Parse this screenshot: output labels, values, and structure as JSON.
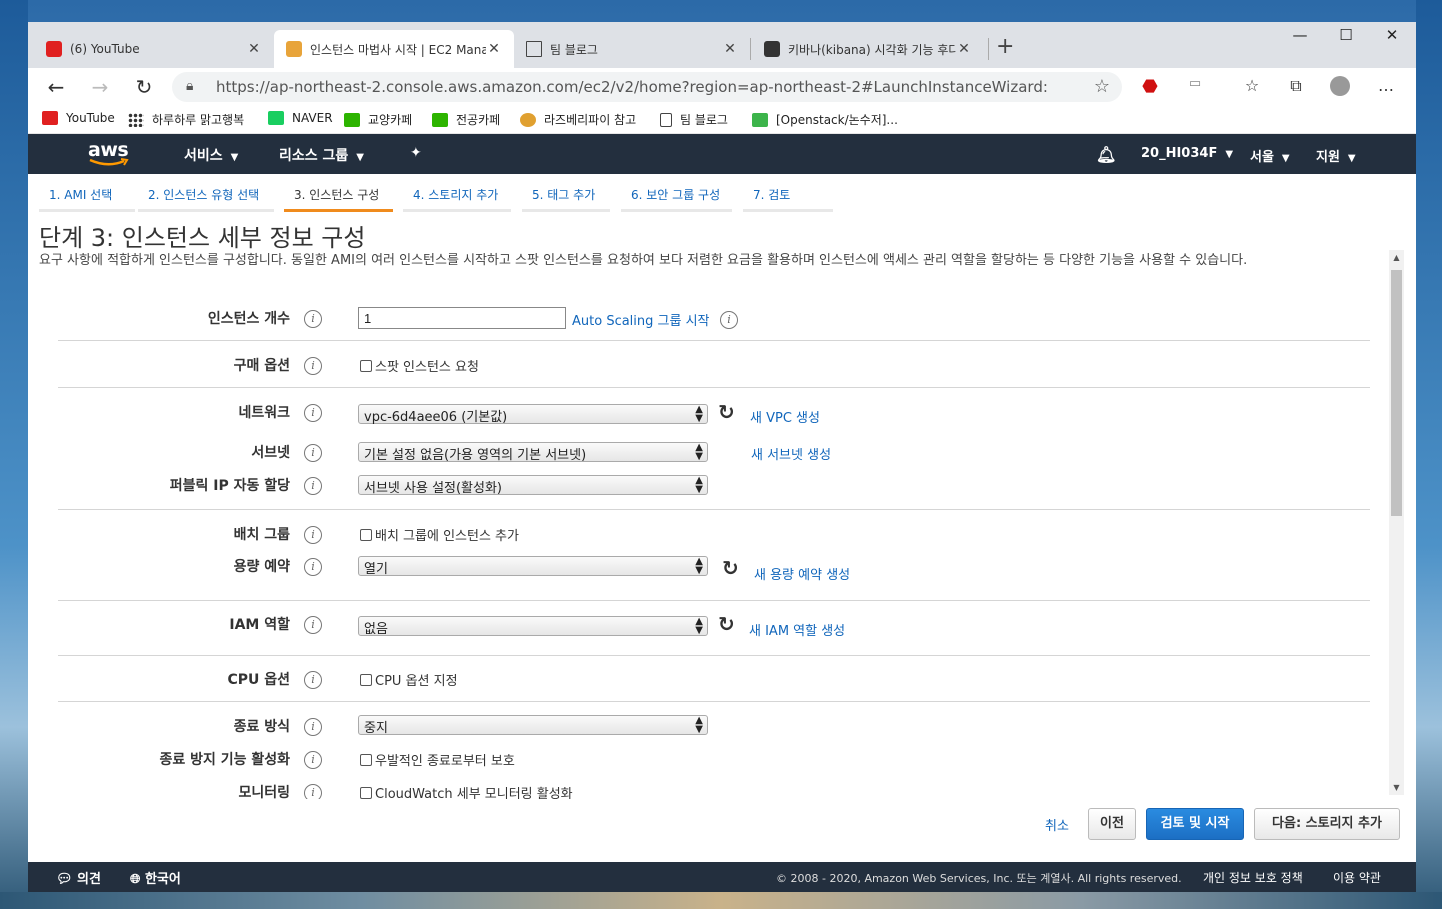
{
  "browser": {
    "tabs": [
      {
        "title": "(6) YouTube"
      },
      {
        "title": "인스턴스 마법사 시작 | EC2 Mana"
      },
      {
        "title": "팀 블로그"
      },
      {
        "title": "키바나(kibana) 시각화 기능 후다"
      }
    ],
    "close_glyph": "✕",
    "new_tab_glyph": "+",
    "window_controls": {
      "minimize": "—",
      "maximize": "☐",
      "close": "✕"
    },
    "url": "https://ap-northeast-2.console.aws.amazon.com/ec2/v2/home?region=ap-northeast-2#LaunchInstanceWizard:",
    "bookmarks": [
      "YouTube",
      "하루하루 맑고행복",
      "NAVER",
      "교양카페",
      "전공카페",
      "라즈베리파이 참고",
      "팀 블로그",
      "[Openstack/논수저]..."
    ],
    "icons": [
      "back-icon",
      "forward-icon",
      "reload-icon",
      "lock-icon",
      "star-icon",
      "stop-icon",
      "reading-icon",
      "favorites-icon",
      "collections-icon",
      "profile-icon",
      "more-icon"
    ]
  },
  "aws_header": {
    "logo": "aws",
    "services": "서비스",
    "resource_groups": "리소스 그룹",
    "account": "20_HI034F",
    "region": "서울",
    "support": "지원"
  },
  "wizard": {
    "steps": [
      "1. AMI 선택",
      "2. 인스턴스 유형 선택",
      "3. 인스턴스 구성",
      "4. 스토리지 추가",
      "5. 태그 추가",
      "6. 보안 그룹 구성",
      "7. 검토"
    ],
    "active_step": 3
  },
  "page": {
    "title": "단계 3: 인스턴스 세부 정보 구성",
    "description": "요구 사항에 적합하게 인스턴스를 구성합니다. 동일한 AMI의 여러 인스턴스를 시작하고 스팟 인스턴스를 요청하여 보다 저렴한 요금을 활용하며 인스턴스에 액세스 관리 역할을 할당하는 등 다양한 기능을 사용할 수 있습니다."
  },
  "form": {
    "instance_count": {
      "label": "인스턴스 개수",
      "value": "1",
      "link": "Auto Scaling 그룹 시작"
    },
    "purchase": {
      "label": "구매 옵션",
      "checkbox": "스팟 인스턴스 요청"
    },
    "network": {
      "label": "네트워크",
      "value": "vpc-6d4aee06 (기본값)",
      "link": "새 VPC 생성"
    },
    "subnet": {
      "label": "서브넷",
      "value": "기본 설정 없음(가용 영역의 기본 서브넷)",
      "link": "새 서브넷 생성"
    },
    "public_ip": {
      "label": "퍼블릭 IP 자동 할당",
      "value": "서브넷 사용 설정(활성화)"
    },
    "placement": {
      "label": "배치 그룹",
      "checkbox": "배치 그룹에 인스턴스 추가"
    },
    "capacity": {
      "label": "용량 예약",
      "value": "열기",
      "link": "새 용량 예약 생성"
    },
    "iam": {
      "label": "IAM 역할",
      "value": "없음",
      "link": "새 IAM 역할 생성"
    },
    "cpu": {
      "label": "CPU 옵션",
      "checkbox": "CPU 옵션 지정"
    },
    "shutdown": {
      "label": "종료 방식",
      "value": "중지"
    },
    "termination": {
      "label": "종료 방지 기능 활성화",
      "checkbox": "우발적인 종료로부터 보호"
    },
    "monitoring": {
      "label": "모니터링",
      "checkbox": "CloudWatch 세부 모니터링 활성화"
    },
    "info_glyph": "i",
    "refresh_glyph": "↻"
  },
  "buttons": {
    "cancel": "취소",
    "previous": "이전",
    "review": "검토 및 시작",
    "next": "다음: 스토리지 추가"
  },
  "footer": {
    "feedback": "의견",
    "language": "한국어",
    "copyright": "© 2008 - 2020, Amazon Web Services, Inc. 또는 계열사. All rights reserved.",
    "privacy": "개인 정보 보호 정책",
    "terms": "이용 약관"
  },
  "colors": {
    "aws_dark": "#232f3e",
    "link": "#1166bb",
    "primary": "#1c6fc4",
    "active_step": "#f08b1d"
  }
}
